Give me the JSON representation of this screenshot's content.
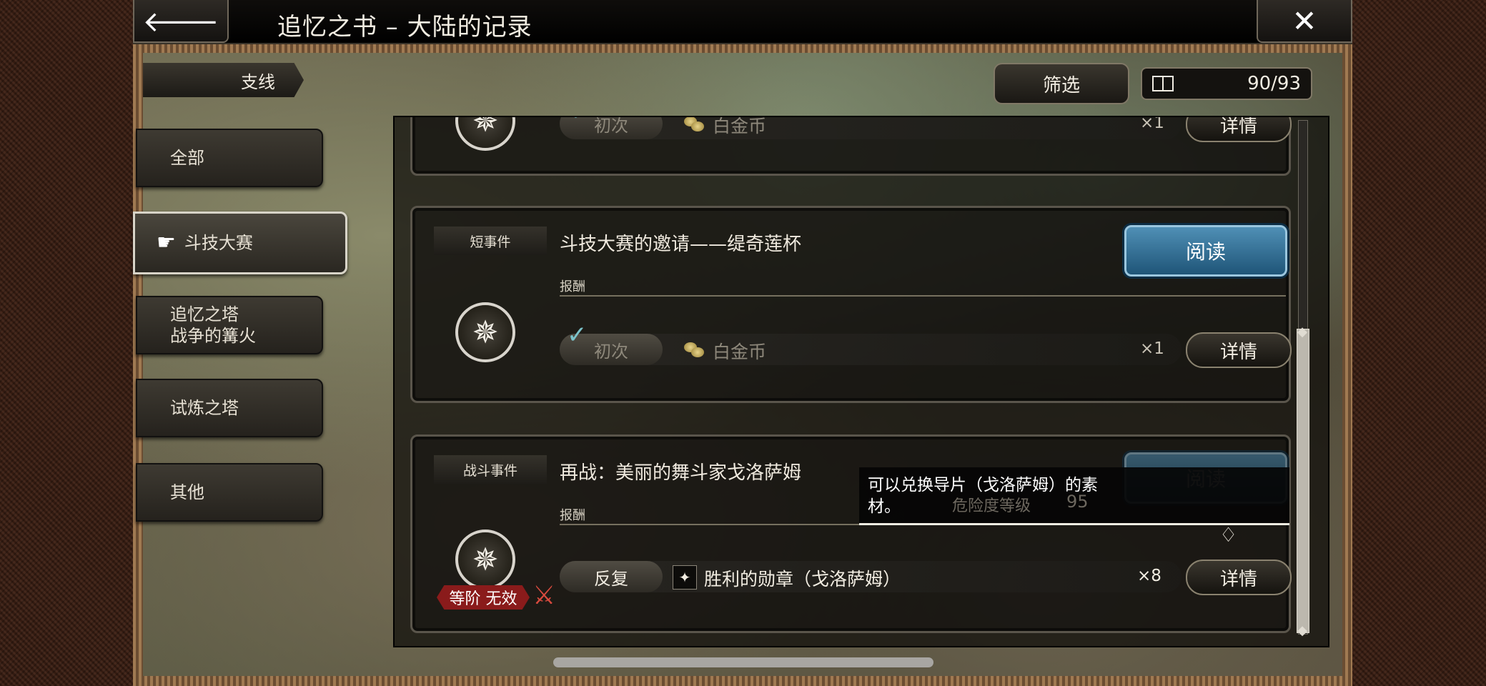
{
  "header": {
    "back_icon": "arrow-left-icon",
    "title": "追忆之书 – 大陆的记录",
    "close_icon": "close-x-icon"
  },
  "sidebar": {
    "category_label": "支线",
    "items": [
      {
        "label": "全部",
        "active": false
      },
      {
        "label": "斗技大赛",
        "active": true
      },
      {
        "label": "追忆之塔\n战争的篝火",
        "active": false
      },
      {
        "label": "试炼之塔",
        "active": false
      },
      {
        "label": "其他",
        "active": false
      }
    ]
  },
  "toolbar": {
    "filter_label": "筛选",
    "count": "90/93"
  },
  "cards": [
    {
      "partial": true,
      "reward_badge": "初次",
      "reward_item": "白金币",
      "reward_qty": "×1",
      "detail_label": "详情"
    },
    {
      "type": "短事件",
      "title": "斗技大赛的邀请——缇奇莲杯",
      "read_label": "阅读",
      "reward_label": "报酬",
      "reward_badge": "初次",
      "reward_item": "白金币",
      "reward_qty": "×1",
      "detail_label": "详情",
      "claimed": true
    },
    {
      "type": "战斗事件",
      "title": "再战：美丽的舞斗家戈洛萨姆",
      "read_label": "阅读",
      "reward_label": "报酬",
      "reward_badge": "反复",
      "reward_item": "胜利的勋章（戈洛萨姆）",
      "reward_qty": "×8",
      "detail_label": "详情",
      "rank_tag": "等阶 无效"
    }
  ],
  "tooltip": {
    "text": "可以兑换导片（戈洛萨姆）的素材。",
    "ghost_label": "危险度等级",
    "ghost_value": "95"
  },
  "colors": {
    "read_button": "#2f6f96",
    "rank_tag": "#8a1b1b",
    "check": "#7cc4cc"
  }
}
